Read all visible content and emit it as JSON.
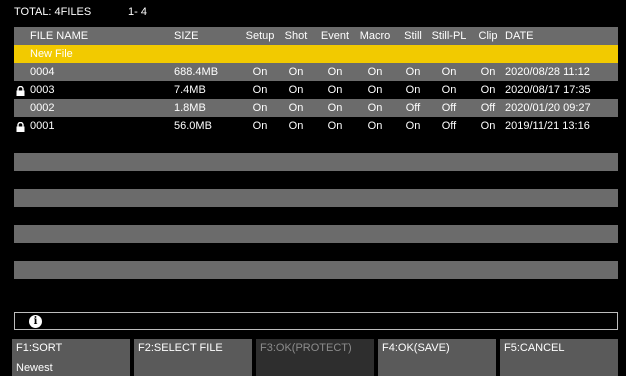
{
  "topbar": {
    "total": "TOTAL: 4FILES",
    "range": "1- 4"
  },
  "table": {
    "headers": {
      "name": "FILE NAME",
      "size": "SIZE",
      "setup": "Setup",
      "shot": "Shot",
      "event": "Event",
      "macro": "Macro",
      "still": "Still",
      "stillpl": "Still-PL",
      "clip": "Clip",
      "date": "DATE"
    },
    "new_file_label": "New File",
    "rows": [
      {
        "name": "0004",
        "size": "688.4MB",
        "setup": "On",
        "shot": "On",
        "event": "On",
        "macro": "On",
        "still": "On",
        "stillpl": "On",
        "clip": "On",
        "date": "2020/08/28 11:12",
        "locked": false
      },
      {
        "name": "0003",
        "size": "7.4MB",
        "setup": "On",
        "shot": "On",
        "event": "On",
        "macro": "On",
        "still": "On",
        "stillpl": "On",
        "clip": "On",
        "date": "2020/08/17 17:35",
        "locked": true
      },
      {
        "name": "0002",
        "size": "1.8MB",
        "setup": "On",
        "shot": "On",
        "event": "On",
        "macro": "On",
        "still": "Off",
        "stillpl": "Off",
        "clip": "Off",
        "date": "2020/01/20 09:27",
        "locked": false
      },
      {
        "name": "0001",
        "size": "56.0MB",
        "setup": "On",
        "shot": "On",
        "event": "On",
        "macro": "On",
        "still": "On",
        "stillpl": "Off",
        "clip": "On",
        "date": "2019/11/21 13:16",
        "locked": true
      }
    ]
  },
  "info": {
    "icon": "info-icon"
  },
  "fkeys": {
    "f1": {
      "label": "F1:SORT",
      "sub": "Newest"
    },
    "f2": {
      "label": "F2:SELECT FILE"
    },
    "f3": {
      "label": "F3:OK(PROTECT)"
    },
    "f4": {
      "label": "F4:OK(SAVE)"
    },
    "f5": {
      "label": "F5:CANCEL"
    }
  },
  "colors": {
    "selection": "#f2ca00",
    "row_gray": "#6b6b6b",
    "fkey": "#5a5a5a",
    "fkey_disabled": "#2e2e2e"
  }
}
